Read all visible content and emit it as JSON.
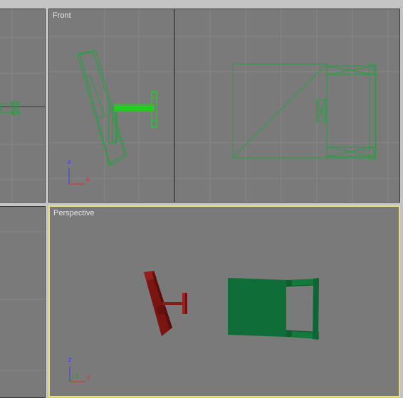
{
  "viewports": {
    "top_left": {
      "label": ""
    },
    "front": {
      "label": "Front",
      "active": false
    },
    "bottom_left": {
      "label": ""
    },
    "perspective": {
      "label": "Perspective",
      "active": true
    }
  },
  "axis_tripod": {
    "z": "z",
    "x": "x",
    "y": "y"
  },
  "colors": {
    "viewport_bg": "#7a7a7a",
    "grid": "#858585",
    "grid_dark": "#3c3c3c",
    "wireframe": "#21a33d",
    "selected_wire": "#1ed21e",
    "active_border": "#e8e070",
    "object_red": "#7a1512",
    "object_green": "#0f6e37",
    "axis_z": "#3a3aff",
    "axis_x": "#e03030",
    "axis_y": "#2c9f2c"
  }
}
